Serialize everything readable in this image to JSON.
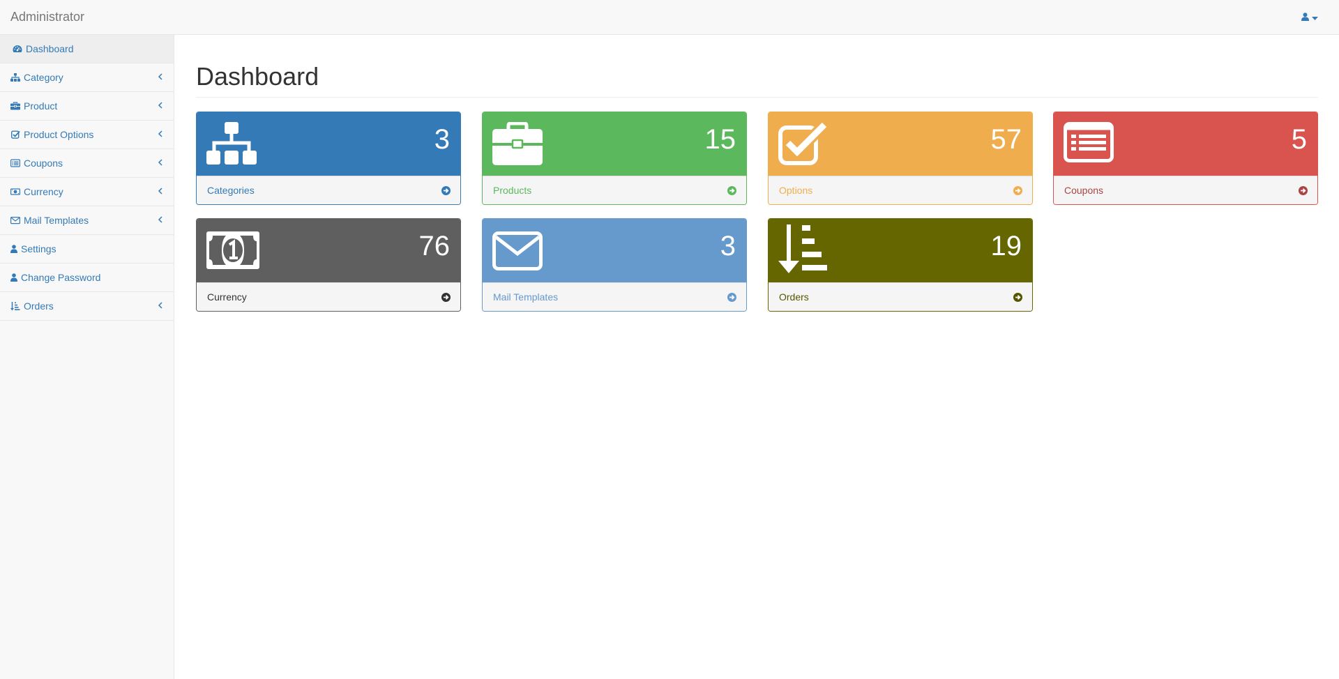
{
  "navbar": {
    "brand": "Administrator",
    "user_icon": "user-icon",
    "caret_icon": "caret-down-icon"
  },
  "sidebar": {
    "items": [
      {
        "label": "Dashboard",
        "icon": "dashboard-icon",
        "active": true,
        "has_submenu": false
      },
      {
        "label": "Category",
        "icon": "sitemap-icon",
        "has_submenu": true
      },
      {
        "label": "Product",
        "icon": "briefcase-icon",
        "has_submenu": true
      },
      {
        "label": "Product Options",
        "icon": "check-square-icon",
        "has_submenu": true
      },
      {
        "label": "Coupons",
        "icon": "list-alt-icon",
        "has_submenu": true
      },
      {
        "label": "Currency",
        "icon": "money-icon",
        "has_submenu": true
      },
      {
        "label": "Mail Templates",
        "icon": "envelope-icon",
        "has_submenu": true
      },
      {
        "label": "Settings",
        "icon": "user-icon",
        "has_submenu": false
      },
      {
        "label": "Change Password",
        "icon": "user-icon",
        "has_submenu": false
      },
      {
        "label": "Orders",
        "icon": "sort-amount-desc-icon",
        "has_submenu": true
      }
    ]
  },
  "main": {
    "title": "Dashboard",
    "panels": [
      {
        "label": "Categories",
        "count": "3",
        "icon": "sitemap-icon",
        "color": "#337ab7",
        "text_color": "#337ab7"
      },
      {
        "label": "Products",
        "count": "15",
        "icon": "briefcase-icon",
        "color": "#5cb85c",
        "text_color": "#5cb85c"
      },
      {
        "label": "Options",
        "count": "57",
        "icon": "check-square-icon",
        "color": "#f0ad4e",
        "text_color": "#f0ad4e"
      },
      {
        "label": "Coupons",
        "count": "5",
        "icon": "list-alt-icon",
        "color": "#d9534f",
        "text_color": "#a94442"
      },
      {
        "label": "Currency",
        "count": "76",
        "icon": "money-icon",
        "color": "#5f5f5f",
        "text_color": "#333333"
      },
      {
        "label": "Mail Templates",
        "count": "3",
        "icon": "envelope-icon",
        "color": "#6699cc",
        "text_color": "#6699cc"
      },
      {
        "label": "Orders",
        "count": "19",
        "icon": "sort-amount-desc-icon",
        "color": "#666600",
        "text_color": "#555500"
      }
    ]
  }
}
